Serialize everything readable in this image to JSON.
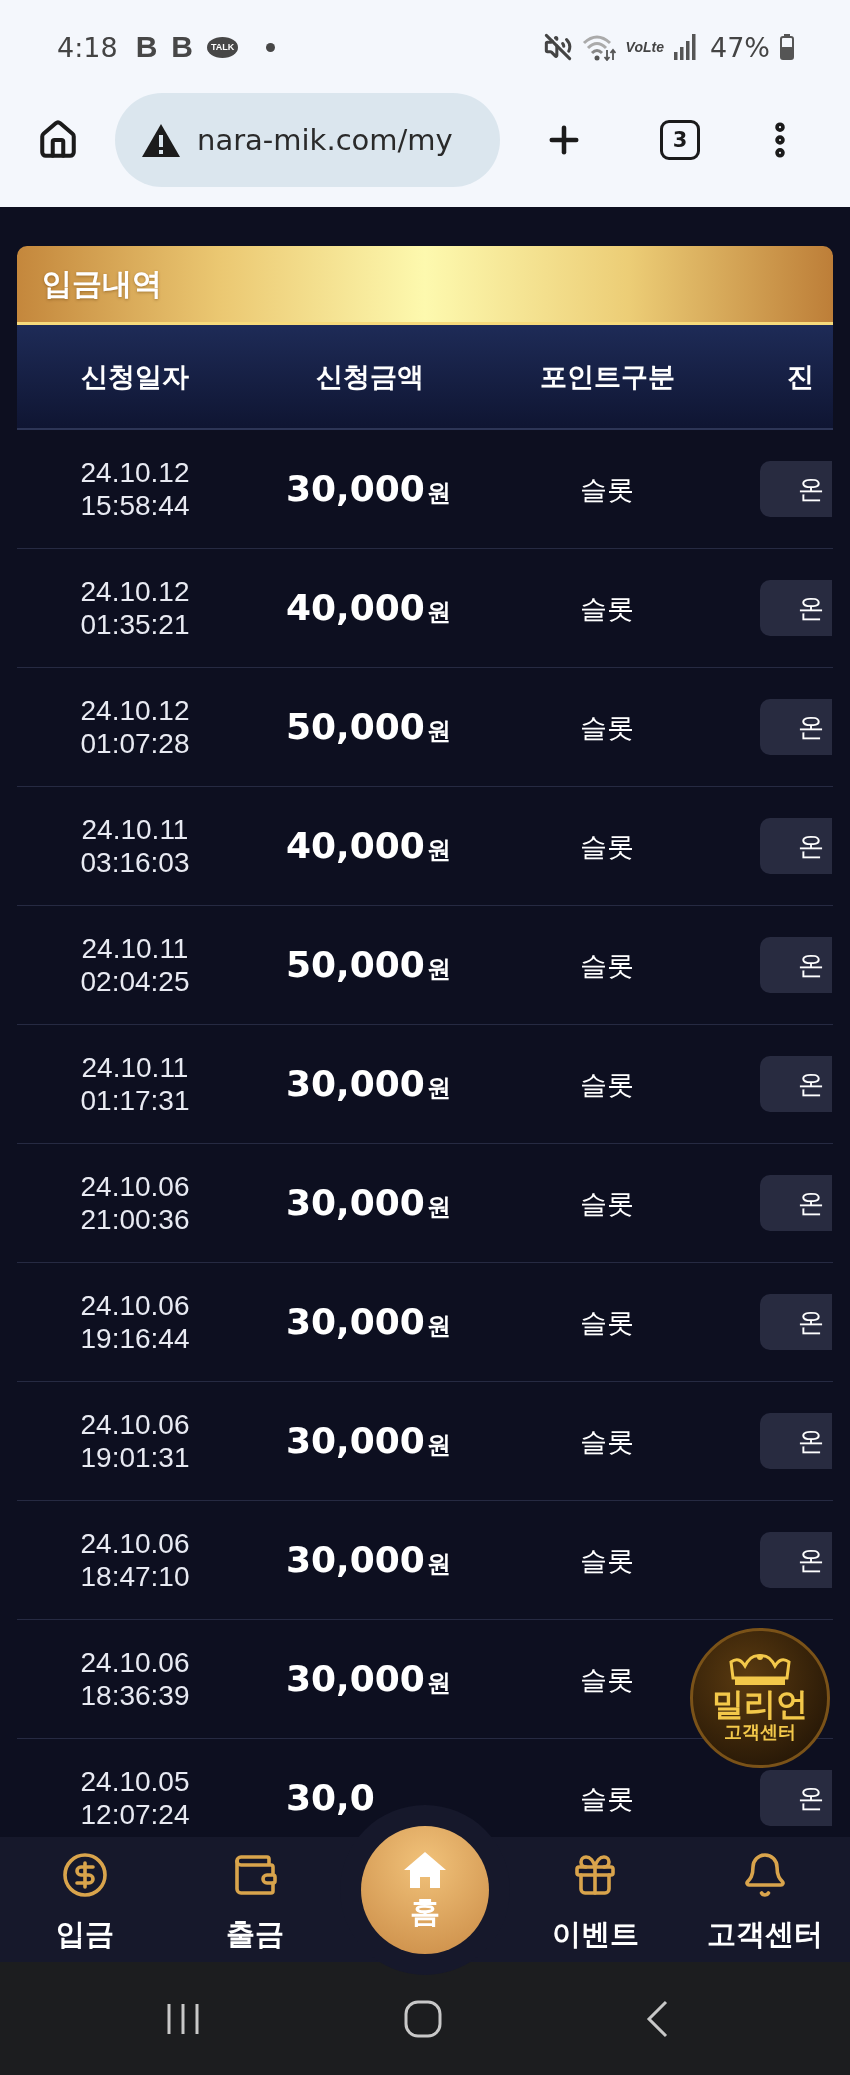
{
  "status_bar": {
    "time": "4:18",
    "notifications": [
      {
        "kind": "letter",
        "text": "B"
      },
      {
        "kind": "letter",
        "text": "B"
      },
      {
        "kind": "bubble",
        "text": "TALK"
      },
      {
        "kind": "dot"
      }
    ],
    "network_label": "VoLte",
    "battery": "47%"
  },
  "browser": {
    "url": "nara-mik.com/my",
    "tab_count": "3"
  },
  "panel": {
    "title": "입금내역"
  },
  "table": {
    "columns": [
      "신청일자",
      "신청금액",
      "포인트구분",
      "진"
    ],
    "rows": [
      {
        "date": "24.10.12",
        "time": "15:58:44",
        "amount": "30,000",
        "unit": "원",
        "point_type": "슬롯",
        "status": "온"
      },
      {
        "date": "24.10.12",
        "time": "01:35:21",
        "amount": "40,000",
        "unit": "원",
        "point_type": "슬롯",
        "status": "온"
      },
      {
        "date": "24.10.12",
        "time": "01:07:28",
        "amount": "50,000",
        "unit": "원",
        "point_type": "슬롯",
        "status": "온"
      },
      {
        "date": "24.10.11",
        "time": "03:16:03",
        "amount": "40,000",
        "unit": "원",
        "point_type": "슬롯",
        "status": "온"
      },
      {
        "date": "24.10.11",
        "time": "02:04:25",
        "amount": "50,000",
        "unit": "원",
        "point_type": "슬롯",
        "status": "온"
      },
      {
        "date": "24.10.11",
        "time": "01:17:31",
        "amount": "30,000",
        "unit": "원",
        "point_type": "슬롯",
        "status": "온"
      },
      {
        "date": "24.10.06",
        "time": "21:00:36",
        "amount": "30,000",
        "unit": "원",
        "point_type": "슬롯",
        "status": "온"
      },
      {
        "date": "24.10.06",
        "time": "19:16:44",
        "amount": "30,000",
        "unit": "원",
        "point_type": "슬롯",
        "status": "온"
      },
      {
        "date": "24.10.06",
        "time": "19:01:31",
        "amount": "30,000",
        "unit": "원",
        "point_type": "슬롯",
        "status": "온"
      },
      {
        "date": "24.10.06",
        "time": "18:47:10",
        "amount": "30,000",
        "unit": "원",
        "point_type": "슬롯",
        "status": "온"
      },
      {
        "date": "24.10.06",
        "time": "18:36:39",
        "amount": "30,000",
        "unit": "원",
        "point_type": "슬롯"
      },
      {
        "date": "24.10.05",
        "time": "12:07:24",
        "amount": "30,0",
        "point_type": "슬롯",
        "status": "온"
      }
    ]
  },
  "floating_badge": {
    "title": "밀리언",
    "subtitle": "고객센터"
  },
  "bottom_nav": [
    {
      "kind": "tab",
      "label": "입금"
    },
    {
      "kind": "tab",
      "label": "출금"
    },
    {
      "kind": "center",
      "label": "홈"
    },
    {
      "kind": "tab",
      "label": "이벤트"
    },
    {
      "kind": "tab",
      "label": "고객센터"
    }
  ]
}
